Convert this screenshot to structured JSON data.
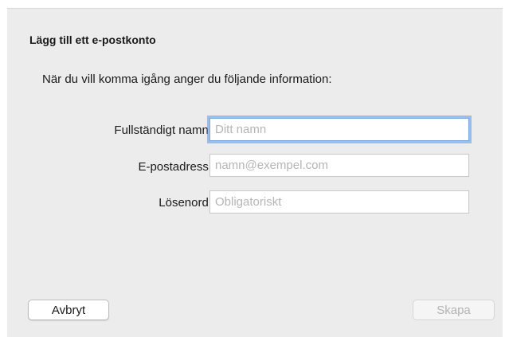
{
  "dialog": {
    "title": "Lägg till ett e-postkonto",
    "intro": "När du vill komma igång anger du följande information:"
  },
  "form": {
    "full_name": {
      "label": "Fullständigt namn:",
      "placeholder": "Ditt namn",
      "value": ""
    },
    "email": {
      "label": "E-postadress:",
      "placeholder": "namn@exempel.com",
      "value": ""
    },
    "password": {
      "label": "Lösenord:",
      "placeholder": "Obligatoriskt",
      "value": ""
    }
  },
  "buttons": {
    "cancel_label": "Avbryt",
    "create_label": "Skapa",
    "create_enabled": false
  },
  "colors": {
    "sheet_background": "#ececec",
    "focus_ring": "#5c96e6",
    "disabled_text": "#b3b3b3"
  }
}
